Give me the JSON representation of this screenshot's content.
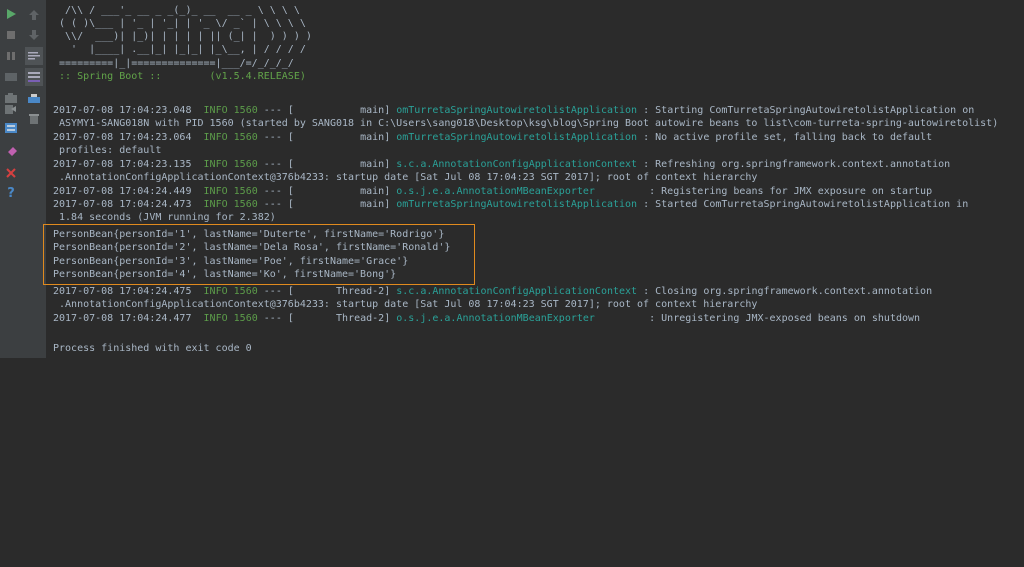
{
  "toolbar": {
    "left": [
      "run-icon",
      "stop-icon",
      "pause-icon",
      "dump-icon",
      "camera-icon",
      "exit-icon",
      "layout-icon",
      "pin-icon",
      "close-icon",
      "help-icon"
    ],
    "right": [
      "up-arrow-icon",
      "down-arrow-icon",
      "soft-wrap-icon",
      "scroll-to-end-icon",
      "print-icon",
      "trash-icon"
    ]
  },
  "console": {
    "banner": [
      "  /\\\\ / ___'_ __ _ _(_)_ __  __ _ \\ \\ \\ \\",
      " ( ( )\\___ | '_ | '_| | '_ \\/ _` | \\ \\ \\ \\",
      "  \\\\/  ___)| |_)| | | | | || (_| |  ) ) ) )",
      "   '  |____| .__|_| |_|_| |_\\__, | / / / /",
      " =========|_|==============|___/=/_/_/_/",
      " :: Spring Boot ::        (v1.5.4.RELEASE)"
    ],
    "log": [
      {
        "ts": "2017-07-08 17:04:23.048",
        "level": "INFO",
        "pid": "1560",
        "sep": "--- [",
        "thread": "           main]",
        "cls": "omTurretaSpringAutowiretolistApplication",
        "msg": ": Starting ComTurretaSpringAutowiretolistApplication on"
      },
      {
        "cont": " ASYMY1-SANG018N with PID 1560 (started by SANG018 in C:\\Users\\sang018\\Desktop\\ksg\\blog\\Spring Boot autowire beans to list\\com-turreta-spring-autowiretolist)"
      },
      {
        "ts": "2017-07-08 17:04:23.064",
        "level": "INFO",
        "pid": "1560",
        "sep": "--- [",
        "thread": "           main]",
        "cls": "omTurretaSpringAutowiretolistApplication",
        "msg": ": No active profile set, falling back to default"
      },
      {
        "cont": " profiles: default"
      },
      {
        "ts": "2017-07-08 17:04:23.135",
        "level": "INFO",
        "pid": "1560",
        "sep": "--- [",
        "thread": "           main]",
        "cls": "s.c.a.AnnotationConfigApplicationContext",
        "msg": ": Refreshing org.springframework.context.annotation"
      },
      {
        "cont": " .AnnotationConfigApplicationContext@376b4233: startup date [Sat Jul 08 17:04:23 SGT 2017]; root of context hierarchy"
      },
      {
        "ts": "2017-07-08 17:04:24.449",
        "level": "INFO",
        "pid": "1560",
        "sep": "--- [",
        "thread": "           main]",
        "cls": "o.s.j.e.a.AnnotationMBeanExporter        ",
        "msg": ": Registering beans for JMX exposure on startup"
      },
      {
        "ts": "2017-07-08 17:04:24.473",
        "level": "INFO",
        "pid": "1560",
        "sep": "--- [",
        "thread": "           main]",
        "cls": "omTurretaSpringAutowiretolistApplication",
        "msg": ": Started ComTurretaSpringAutowiretolistApplication in"
      },
      {
        "cont": " 1.84 seconds (JVM running for 2.382)"
      },
      {
        "plain": "PersonBean{personId='1', lastName='Duterte', firstName='Rodrigo'}"
      },
      {
        "plain": "PersonBean{personId='2', lastName='Dela Rosa', firstName='Ronald'}"
      },
      {
        "plain": "PersonBean{personId='3', lastName='Poe', firstName='Grace'}"
      },
      {
        "plain": "PersonBean{personId='4', lastName='Ko', firstName='Bong'}"
      },
      {
        "ts": "2017-07-08 17:04:24.475",
        "level": "INFO",
        "pid": "1560",
        "sep": "--- [",
        "thread": "       Thread-2]",
        "cls": "s.c.a.AnnotationConfigApplicationContext",
        "msg": ": Closing org.springframework.context.annotation"
      },
      {
        "cont": " .AnnotationConfigApplicationContext@376b4233: startup date [Sat Jul 08 17:04:23 SGT 2017]; root of context hierarchy"
      },
      {
        "ts": "2017-07-08 17:04:24.477",
        "level": "INFO",
        "pid": "1560",
        "sep": "--- [",
        "thread": "       Thread-2]",
        "cls": "o.s.j.e.a.AnnotationMBeanExporter        ",
        "msg": ": Unregistering JMX-exposed beans on shutdown"
      },
      {
        "plain": ""
      },
      {
        "plain": "Process finished with exit code 0"
      }
    ]
  },
  "colors": {
    "background": "#2b2b2b",
    "text": "#a9b7c6",
    "info": "#5c9c4a",
    "class": "#2aa198",
    "highlight": "#e08a1e"
  }
}
